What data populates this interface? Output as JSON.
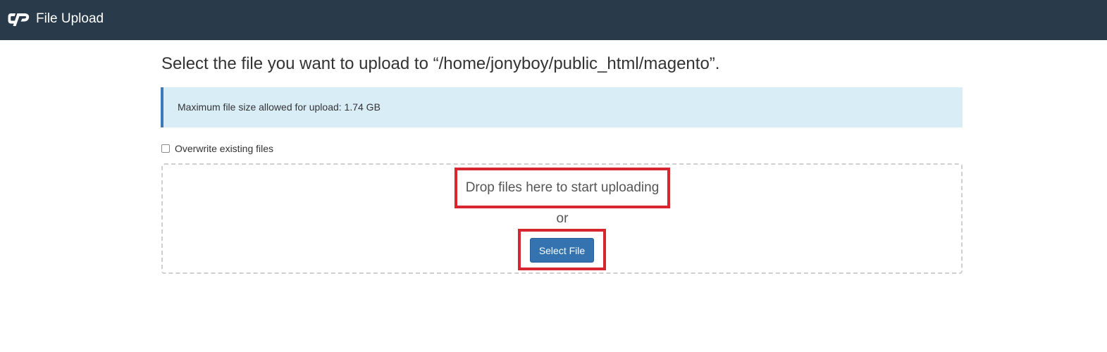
{
  "header": {
    "app_title": "File Upload",
    "logo_icon": "cpanel-logo-icon",
    "background_color": "#293a4a"
  },
  "main": {
    "heading": "Select the file you want to upload to “/home/jonyboy/public_html/magento”.",
    "info_message": "Maximum file size allowed for upload: 1.74 GB",
    "overwrite_label": "Overwrite existing files",
    "overwrite_checked": false,
    "drop_text": "Drop files here to start uploading",
    "or_text": "or",
    "select_file_label": "Select File"
  },
  "colors": {
    "accent": "#3572b0",
    "info_background": "#d9edf7",
    "highlight": "#d7262f"
  }
}
